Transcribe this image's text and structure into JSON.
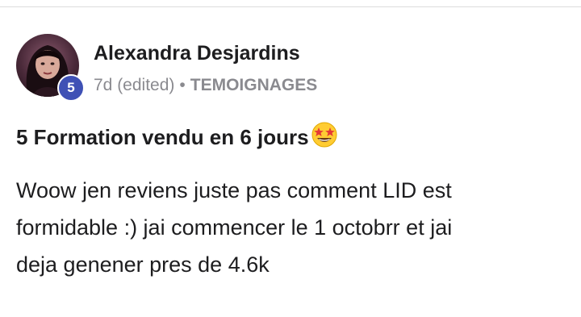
{
  "author": {
    "name": "Alexandra Desjardins",
    "level": "5",
    "avatar_icon": "user-avatar-photo"
  },
  "meta": {
    "time": "7d (edited)",
    "separator": "•",
    "category": "TEMOIGNAGES"
  },
  "post": {
    "title": "5 Formation vendu en 6 jours",
    "title_emoji_icon": "star-struck-emoji-icon",
    "body_lines": [
      "Woow jen reviens juste pas comment LID est",
      "formidable :) jai commencer le 1 octobrr et jai",
      "deja genener pres de 4.6k"
    ]
  },
  "colors": {
    "badge": "#3f51b5",
    "meta_text": "#8a8a8f",
    "text": "#1d1d1f"
  }
}
